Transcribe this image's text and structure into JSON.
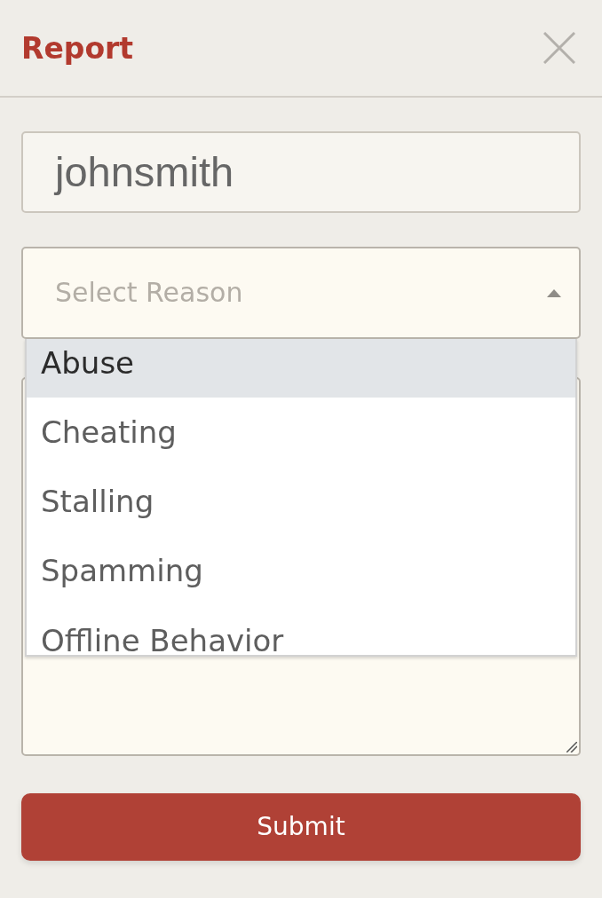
{
  "dialog": {
    "title": "Report"
  },
  "username_field": {
    "value": "johnsmith"
  },
  "reason_select": {
    "placeholder": "Select Reason",
    "expanded": true,
    "options": [
      {
        "label": "Abuse",
        "selected": true
      },
      {
        "label": "Cheating",
        "selected": false
      },
      {
        "label": "Stalling",
        "selected": false
      },
      {
        "label": "Spamming",
        "selected": false
      },
      {
        "label": "Offline Behavior",
        "selected": false
      }
    ]
  },
  "submit_button": {
    "label": "Submit"
  }
}
